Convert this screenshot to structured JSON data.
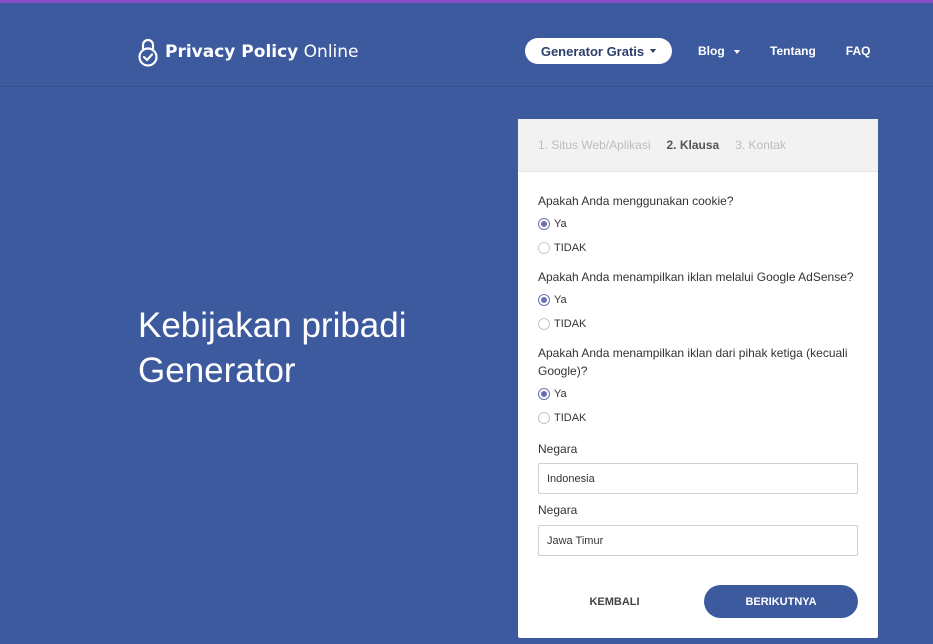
{
  "header": {
    "logo_bold": "Privacy Policy",
    "logo_light": "Online",
    "nav": {
      "generator": "Generator Gratis",
      "blog": "Blog",
      "tentang": "Tentang",
      "faq": "FAQ"
    }
  },
  "hero": {
    "line1": "Kebijakan pribadi",
    "line2": "Generator"
  },
  "steps": {
    "step1": "1. Situs Web/Aplikasi",
    "step2": "2. Klausa",
    "step3": "3. Kontak"
  },
  "form": {
    "q1": {
      "text": "Apakah Anda menggunakan cookie?",
      "yes": "Ya",
      "no": "TIDAK",
      "selected": "Ya"
    },
    "q2": {
      "text": "Apakah Anda menampilkan iklan melalui Google AdSense?",
      "yes": "Ya",
      "no": "TIDAK",
      "selected": "Ya"
    },
    "q3": {
      "text": "Apakah Anda menampilkan iklan dari pihak ketiga (kecuali Google)?",
      "yes": "Ya",
      "no": "TIDAK",
      "selected": "Ya"
    },
    "country_label": "Negara",
    "country_value": "Indonesia",
    "region_label": "Negara",
    "region_value": "Jawa Timur"
  },
  "buttons": {
    "back": "KEMBALI",
    "next": "BERIKUTNYA"
  },
  "colors": {
    "background": "#3d5a9e",
    "accent_topline": "#8a4fc7",
    "radio": "#6c6fb0"
  },
  "icons": {
    "logo": "lock-check-icon",
    "dropdown": "caret-down-icon"
  }
}
